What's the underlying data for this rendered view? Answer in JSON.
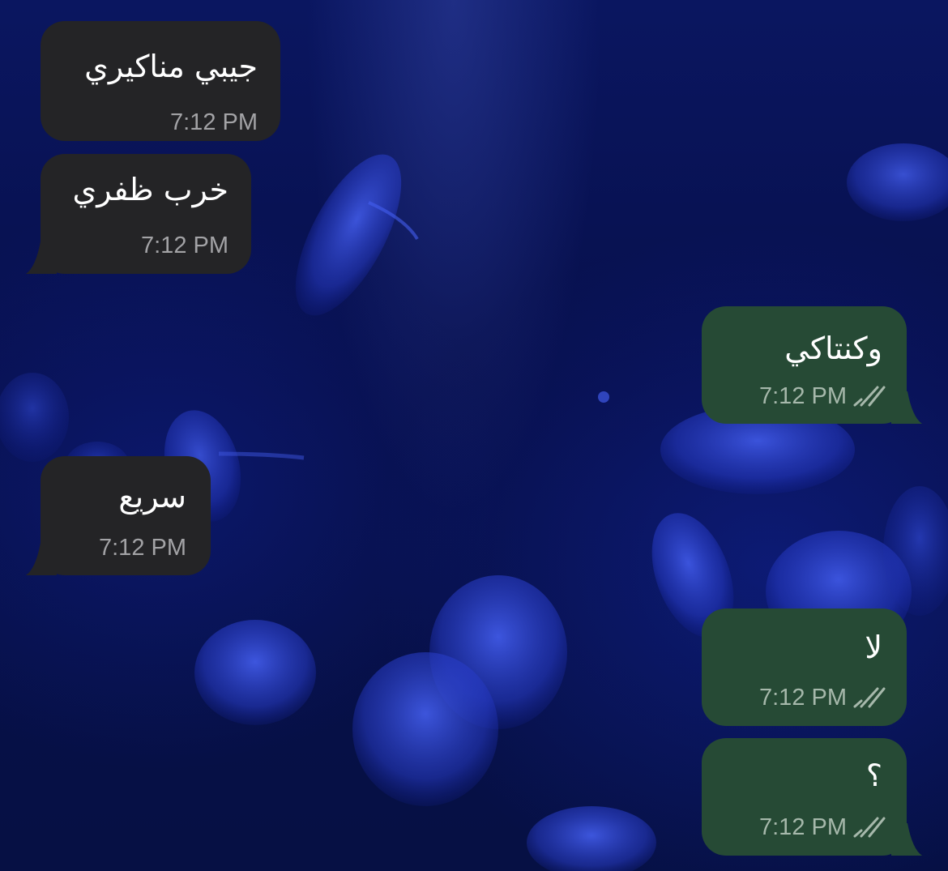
{
  "wallpaper": {
    "description_icon": "jellyfish-wallpaper",
    "colors": {
      "deep": "#070f4a",
      "glow": "#3a52e0"
    }
  },
  "colors": {
    "incoming_bubble": "#242426",
    "outgoing_bubble": "#264a35",
    "time_text": "#a3a3a6"
  },
  "messages": [
    {
      "direction": "incoming",
      "text": "جيبي مناكيري",
      "time": "7:12 PM"
    },
    {
      "direction": "incoming",
      "text": "خرب ظفري",
      "time": "7:12 PM"
    },
    {
      "direction": "outgoing",
      "text": "وكنتاكي",
      "time": "7:12 PM",
      "status_icon": "double-check-icon"
    },
    {
      "direction": "incoming",
      "text": "سريع",
      "time": "7:12 PM"
    },
    {
      "direction": "outgoing",
      "text": "لا",
      "time": "7:12 PM",
      "status_icon": "double-check-icon"
    },
    {
      "direction": "outgoing",
      "text": "؟",
      "time": "7:12 PM",
      "status_icon": "double-check-icon"
    }
  ]
}
